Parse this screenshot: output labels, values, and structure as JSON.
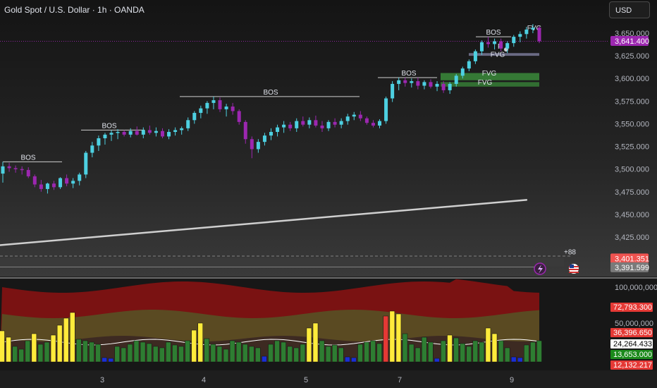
{
  "header": {
    "title": "Gold Spot / U.S. Dollar · 1h · OANDA",
    "currency_button": "USD"
  },
  "colors": {
    "bull": "#4dd0e1",
    "bear": "#9c27b0",
    "vol_green": "#2e7d32",
    "vol_yellow": "#ffeb3b",
    "vol_red": "#e53935",
    "vol_blue": "#1a2fd6",
    "fvg_green": "#3a8a3a"
  },
  "price_axis": {
    "ticks": [
      "3,650.000",
      "3,625.000",
      "3,600.000",
      "3,575.000",
      "3,550.000",
      "3,525.000",
      "3,500.000",
      "3,475.000",
      "3,450.000",
      "3,425.000"
    ]
  },
  "price_badges": [
    {
      "label": "3,641.400",
      "color": "#9c27b0"
    },
    {
      "label": "3,401.351",
      "color": "#ef5350"
    },
    {
      "label": "3,391.599",
      "color": "#7a7a7a"
    }
  ],
  "volume_axis": {
    "ticks": [
      "100,000,000",
      "50,000,000"
    ]
  },
  "volume_badges": [
    {
      "label": "72,793.300",
      "color": "#e53935"
    },
    {
      "label": "36,396.650",
      "color": "#e53935"
    },
    {
      "label": "24,264.433",
      "color": "#ffffff"
    },
    {
      "label": "13,653.000",
      "color": "#1b8a1b"
    },
    {
      "label": "12,132.217",
      "color": "#e53935"
    }
  ],
  "time_axis": {
    "labels": [
      "3",
      "4",
      "5",
      "7",
      "9"
    ]
  },
  "annotations": {
    "bos": [
      "BOS",
      "BOS",
      "BOS",
      "BOS",
      "BOS"
    ],
    "fvg": [
      "FVG",
      "FVG",
      "FVG",
      "FVG",
      "F"
    ],
    "extra": "+88"
  },
  "chart_data": {
    "type": "candlestick",
    "title": "Gold Spot / U.S. Dollar · 1h · OANDA",
    "y_range": [
      3400,
      3670
    ],
    "candles": [
      [
        3495,
        3508,
        3485,
        3503
      ],
      [
        3503,
        3507,
        3497,
        3501
      ],
      [
        3501,
        3504,
        3496,
        3500
      ],
      [
        3500,
        3503,
        3494,
        3499
      ],
      [
        3499,
        3502,
        3490,
        3492
      ],
      [
        3492,
        3494,
        3480,
        3483
      ],
      [
        3483,
        3488,
        3475,
        3478
      ],
      [
        3478,
        3485,
        3473,
        3484
      ],
      [
        3484,
        3487,
        3477,
        3480
      ],
      [
        3480,
        3491,
        3478,
        3490
      ],
      [
        3490,
        3494,
        3481,
        3484
      ],
      [
        3484,
        3490,
        3479,
        3487
      ],
      [
        3487,
        3496,
        3482,
        3494
      ],
      [
        3494,
        3520,
        3490,
        3518
      ],
      [
        3518,
        3530,
        3513,
        3526
      ],
      [
        3526,
        3537,
        3520,
        3534
      ],
      [
        3534,
        3540,
        3527,
        3538
      ],
      [
        3538,
        3543,
        3531,
        3540
      ],
      [
        3540,
        3544,
        3533,
        3541
      ],
      [
        3541,
        3543,
        3536,
        3538
      ],
      [
        3538,
        3545,
        3535,
        3542
      ],
      [
        3542,
        3547,
        3537,
        3538
      ],
      [
        3538,
        3546,
        3534,
        3543
      ],
      [
        3543,
        3548,
        3538,
        3540
      ],
      [
        3540,
        3546,
        3536,
        3542
      ],
      [
        3542,
        3545,
        3534,
        3536
      ],
      [
        3536,
        3544,
        3533,
        3541
      ],
      [
        3541,
        3546,
        3537,
        3543
      ],
      [
        3543,
        3547,
        3538,
        3545
      ],
      [
        3545,
        3557,
        3542,
        3554
      ],
      [
        3554,
        3564,
        3550,
        3562
      ],
      [
        3562,
        3570,
        3556,
        3567
      ],
      [
        3567,
        3575,
        3561,
        3573
      ],
      [
        3573,
        3580,
        3566,
        3576
      ],
      [
        3576,
        3579,
        3563,
        3566
      ],
      [
        3566,
        3572,
        3558,
        3569
      ],
      [
        3569,
        3573,
        3560,
        3564
      ],
      [
        3564,
        3566,
        3549,
        3552
      ],
      [
        3552,
        3554,
        3528,
        3533
      ],
      [
        3533,
        3536,
        3512,
        3522
      ],
      [
        3522,
        3533,
        3518,
        3530
      ],
      [
        3530,
        3540,
        3526,
        3537
      ],
      [
        3537,
        3545,
        3532,
        3541
      ],
      [
        3541,
        3549,
        3536,
        3546
      ],
      [
        3546,
        3553,
        3540,
        3549
      ],
      [
        3549,
        3552,
        3542,
        3545
      ],
      [
        3545,
        3556,
        3541,
        3553
      ],
      [
        3553,
        3558,
        3547,
        3549
      ],
      [
        3549,
        3557,
        3545,
        3554
      ],
      [
        3554,
        3559,
        3546,
        3548
      ],
      [
        3548,
        3553,
        3541,
        3545
      ],
      [
        3545,
        3554,
        3542,
        3552
      ],
      [
        3552,
        3556,
        3546,
        3549
      ],
      [
        3549,
        3556,
        3545,
        3553
      ],
      [
        3553,
        3561,
        3549,
        3558
      ],
      [
        3558,
        3563,
        3554,
        3560
      ],
      [
        3560,
        3564,
        3553,
        3556
      ],
      [
        3556,
        3558,
        3549,
        3551
      ],
      [
        3551,
        3554,
        3546,
        3548
      ],
      [
        3548,
        3555,
        3545,
        3553
      ],
      [
        3553,
        3580,
        3550,
        3578
      ],
      [
        3578,
        3597,
        3574,
        3594
      ],
      [
        3594,
        3601,
        3587,
        3598
      ],
      [
        3598,
        3601,
        3591,
        3595
      ],
      [
        3595,
        3600,
        3590,
        3597
      ],
      [
        3597,
        3601,
        3588,
        3592
      ],
      [
        3592,
        3598,
        3588,
        3596
      ],
      [
        3596,
        3599,
        3589,
        3591
      ],
      [
        3591,
        3597,
        3586,
        3594
      ],
      [
        3594,
        3597,
        3584,
        3587
      ],
      [
        3587,
        3596,
        3583,
        3594
      ],
      [
        3594,
        3605,
        3591,
        3603
      ],
      [
        3603,
        3613,
        3600,
        3611
      ],
      [
        3611,
        3621,
        3608,
        3619
      ],
      [
        3619,
        3632,
        3616,
        3630
      ],
      [
        3630,
        3642,
        3626,
        3640
      ],
      [
        3640,
        3646,
        3634,
        3638
      ],
      [
        3638,
        3644,
        3632,
        3641
      ],
      [
        3641,
        3644,
        3630,
        3633
      ],
      [
        3633,
        3641,
        3628,
        3639
      ],
      [
        3639,
        3648,
        3635,
        3646
      ],
      [
        3646,
        3652,
        3640,
        3649
      ],
      [
        3649,
        3657,
        3644,
        3654
      ],
      [
        3654,
        3660,
        3650,
        3656
      ],
      [
        3656,
        3658,
        3639,
        3641
      ]
    ],
    "trendline": {
      "from": [
        0,
        3416
      ],
      "to": [
        82,
        3466
      ]
    },
    "volume": {
      "y_range": [
        0,
        110000000
      ],
      "bars": [
        [
          44,
          "yellow"
        ],
        [
          35,
          "yellow"
        ],
        [
          22,
          "green"
        ],
        [
          18,
          "green"
        ],
        [
          30,
          "green"
        ],
        [
          40,
          "yellow"
        ],
        [
          25,
          "green"
        ],
        [
          28,
          "green"
        ],
        [
          38,
          "yellow"
        ],
        [
          52,
          "yellow"
        ],
        [
          62,
          "yellow"
        ],
        [
          70,
          "yellow"
        ],
        [
          32,
          "green"
        ],
        [
          30,
          "green"
        ],
        [
          28,
          "green"
        ],
        [
          25,
          "green"
        ],
        [
          6,
          "blue"
        ],
        [
          5,
          "blue"
        ],
        [
          22,
          "green"
        ],
        [
          20,
          "green"
        ],
        [
          25,
          "green"
        ],
        [
          30,
          "green"
        ],
        [
          28,
          "green"
        ],
        [
          26,
          "green"
        ],
        [
          22,
          "green"
        ],
        [
          20,
          "green"
        ],
        [
          28,
          "green"
        ],
        [
          24,
          "green"
        ],
        [
          22,
          "green"
        ],
        [
          30,
          "green"
        ],
        [
          45,
          "yellow"
        ],
        [
          55,
          "yellow"
        ],
        [
          33,
          "green"
        ],
        [
          25,
          "green"
        ],
        [
          22,
          "green"
        ],
        [
          18,
          "green"
        ],
        [
          30,
          "green"
        ],
        [
          28,
          "green"
        ],
        [
          25,
          "green"
        ],
        [
          22,
          "green"
        ],
        [
          20,
          "green"
        ],
        [
          8,
          "blue"
        ],
        [
          25,
          "green"
        ],
        [
          30,
          "green"
        ],
        [
          28,
          "green"
        ],
        [
          22,
          "green"
        ],
        [
          20,
          "green"
        ],
        [
          25,
          "green"
        ],
        [
          48,
          "yellow"
        ],
        [
          55,
          "yellow"
        ],
        [
          30,
          "green"
        ],
        [
          22,
          "green"
        ],
        [
          24,
          "green"
        ],
        [
          20,
          "green"
        ],
        [
          7,
          "blue"
        ],
        [
          6,
          "blue"
        ],
        [
          25,
          "green"
        ],
        [
          28,
          "green"
        ],
        [
          30,
          "green"
        ],
        [
          26,
          "green"
        ],
        [
          65,
          "red"
        ],
        [
          72,
          "yellow"
        ],
        [
          68,
          "yellow"
        ],
        [
          40,
          "green"
        ],
        [
          25,
          "green"
        ],
        [
          20,
          "green"
        ],
        [
          35,
          "green"
        ],
        [
          28,
          "green"
        ],
        [
          5,
          "blue"
        ],
        [
          30,
          "green"
        ],
        [
          38,
          "yellow"
        ],
        [
          34,
          "green"
        ],
        [
          26,
          "green"
        ],
        [
          22,
          "green"
        ],
        [
          30,
          "green"
        ],
        [
          28,
          "green"
        ],
        [
          48,
          "yellow"
        ],
        [
          40,
          "yellow"
        ],
        [
          30,
          "green"
        ],
        [
          20,
          "green"
        ],
        [
          7,
          "blue"
        ],
        [
          6,
          "blue"
        ],
        [
          24,
          "green"
        ],
        [
          28,
          "green"
        ],
        [
          30,
          "green"
        ]
      ]
    }
  }
}
